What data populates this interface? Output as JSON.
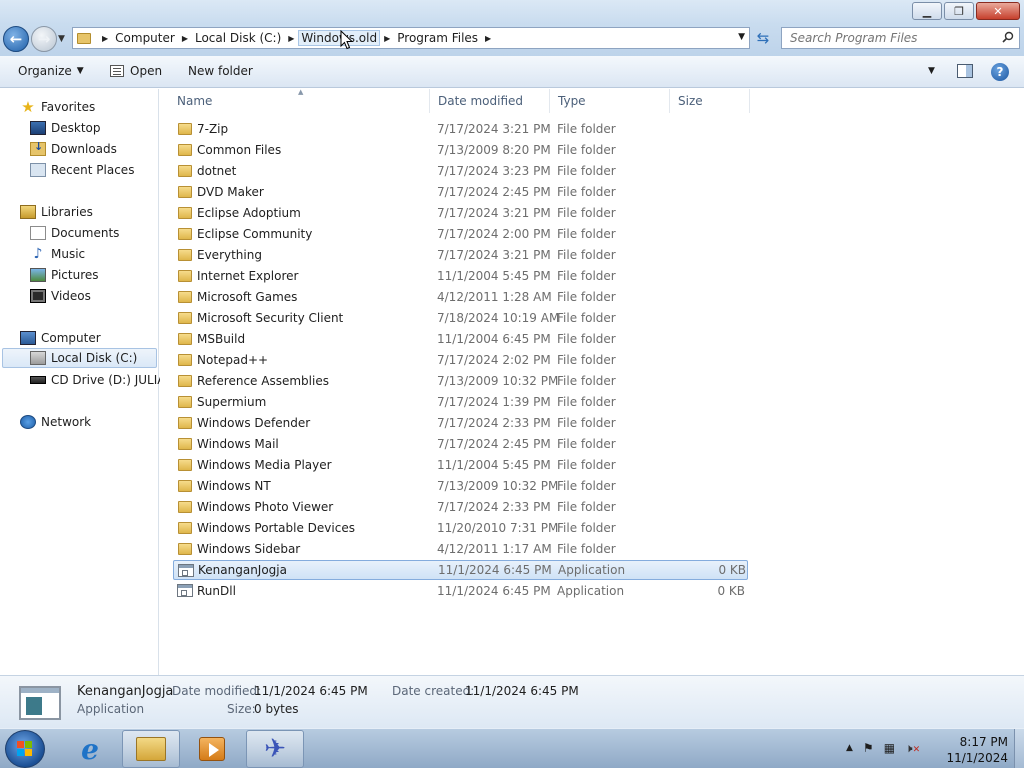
{
  "titlebar": {
    "min_icon": "minimize-icon",
    "max_icon": "restore-icon",
    "close_icon": "close-icon"
  },
  "address": {
    "crumbs": [
      "Computer",
      "Local Disk (C:)",
      "Windows.old",
      "Program Files"
    ]
  },
  "search": {
    "placeholder": "Search Program Files"
  },
  "toolbar": {
    "organize": "Organize",
    "open": "Open",
    "new_folder": "New folder"
  },
  "nav": {
    "favorites": "Favorites",
    "desktop": "Desktop",
    "downloads": "Downloads",
    "recent": "Recent Places",
    "libraries": "Libraries",
    "documents": "Documents",
    "music": "Music",
    "pictures": "Pictures",
    "videos": "Videos",
    "computer": "Computer",
    "local_disk": "Local Disk (C:)",
    "cd_drive": "CD Drive (D:) JULIA",
    "network": "Network"
  },
  "columns": {
    "name": "Name",
    "date": "Date modified",
    "type": "Type",
    "size": "Size"
  },
  "files": [
    {
      "name": "7-Zip",
      "date": "7/17/2024 3:21 PM",
      "type": "File folder",
      "size": ""
    },
    {
      "name": "Common Files",
      "date": "7/13/2009 8:20 PM",
      "type": "File folder",
      "size": ""
    },
    {
      "name": "dotnet",
      "date": "7/17/2024 3:23 PM",
      "type": "File folder",
      "size": ""
    },
    {
      "name": "DVD Maker",
      "date": "7/17/2024 2:45 PM",
      "type": "File folder",
      "size": ""
    },
    {
      "name": "Eclipse Adoptium",
      "date": "7/17/2024 3:21 PM",
      "type": "File folder",
      "size": ""
    },
    {
      "name": "Eclipse Community",
      "date": "7/17/2024 2:00 PM",
      "type": "File folder",
      "size": ""
    },
    {
      "name": "Everything",
      "date": "7/17/2024 3:21 PM",
      "type": "File folder",
      "size": ""
    },
    {
      "name": "Internet Explorer",
      "date": "11/1/2004 5:45 PM",
      "type": "File folder",
      "size": ""
    },
    {
      "name": "Microsoft Games",
      "date": "4/12/2011 1:28 AM",
      "type": "File folder",
      "size": ""
    },
    {
      "name": "Microsoft Security Client",
      "date": "7/18/2024 10:19 AM",
      "type": "File folder",
      "size": ""
    },
    {
      "name": "MSBuild",
      "date": "11/1/2004 6:45 PM",
      "type": "File folder",
      "size": ""
    },
    {
      "name": "Notepad++",
      "date": "7/17/2024 2:02 PM",
      "type": "File folder",
      "size": ""
    },
    {
      "name": "Reference Assemblies",
      "date": "7/13/2009 10:32 PM",
      "type": "File folder",
      "size": ""
    },
    {
      "name": "Supermium",
      "date": "7/17/2024 1:39 PM",
      "type": "File folder",
      "size": ""
    },
    {
      "name": "Windows Defender",
      "date": "7/17/2024 2:33 PM",
      "type": "File folder",
      "size": ""
    },
    {
      "name": "Windows Mail",
      "date": "7/17/2024 2:45 PM",
      "type": "File folder",
      "size": ""
    },
    {
      "name": "Windows Media Player",
      "date": "11/1/2004 5:45 PM",
      "type": "File folder",
      "size": ""
    },
    {
      "name": "Windows NT",
      "date": "7/13/2009 10:32 PM",
      "type": "File folder",
      "size": ""
    },
    {
      "name": "Windows Photo Viewer",
      "date": "7/17/2024 2:33 PM",
      "type": "File folder",
      "size": ""
    },
    {
      "name": "Windows Portable Devices",
      "date": "11/20/2010 7:31 PM",
      "type": "File folder",
      "size": ""
    },
    {
      "name": "Windows Sidebar",
      "date": "4/12/2011 1:17 AM",
      "type": "File folder",
      "size": ""
    },
    {
      "name": "KenanganJogja",
      "date": "11/1/2024 6:45 PM",
      "type": "Application",
      "size": "0 KB"
    },
    {
      "name": "RunDll",
      "date": "11/1/2024 6:45 PM",
      "type": "Application",
      "size": "0 KB"
    }
  ],
  "details": {
    "name": "KenanganJogja",
    "kind": "Application",
    "date_modified_label": "Date modified:",
    "date_modified": "11/1/2024 6:45 PM",
    "date_created_label": "Date created:",
    "date_created": "11/1/2024 6:45 PM",
    "size_label": "Size:",
    "size": "0 bytes"
  },
  "taskbar": {
    "time": "8:17 PM",
    "date": "11/1/2024"
  },
  "colors": {
    "selection": "#cfe2f6",
    "accent": "#1f5fa8",
    "folder": "#dfb64b"
  }
}
